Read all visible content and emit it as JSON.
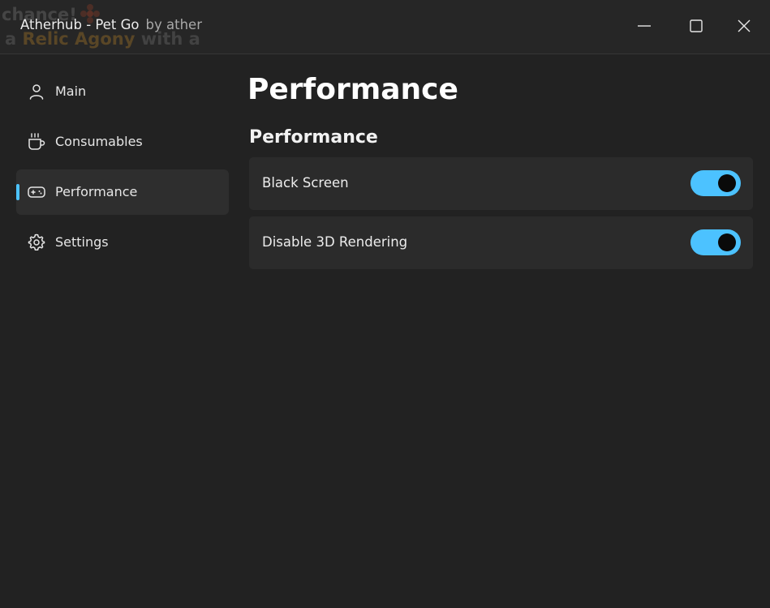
{
  "window": {
    "title": "Atherhub - Pet Go",
    "subtitle": "by ather"
  },
  "background_overlay": {
    "line1": "chance!",
    "line2_prefix": "a",
    "line2_highlight": "Relic Agony",
    "line2_suffix": "with a"
  },
  "sidebar": {
    "items": [
      {
        "label": "Main",
        "icon": "person-icon",
        "active": false
      },
      {
        "label": "Consumables",
        "icon": "cup-icon",
        "active": false
      },
      {
        "label": "Performance",
        "icon": "gamepad-icon",
        "active": true
      },
      {
        "label": "Settings",
        "icon": "gear-icon",
        "active": false
      }
    ]
  },
  "main": {
    "page_title": "Performance",
    "section_title": "Performance",
    "toggles": [
      {
        "label": "Black Screen",
        "on": true
      },
      {
        "label": "Disable 3D Rendering",
        "on": true
      }
    ]
  },
  "colors": {
    "accent": "#4cc2ff",
    "background": "#222222",
    "card": "#2b2b2b",
    "active_nav": "#2e2e2e"
  }
}
